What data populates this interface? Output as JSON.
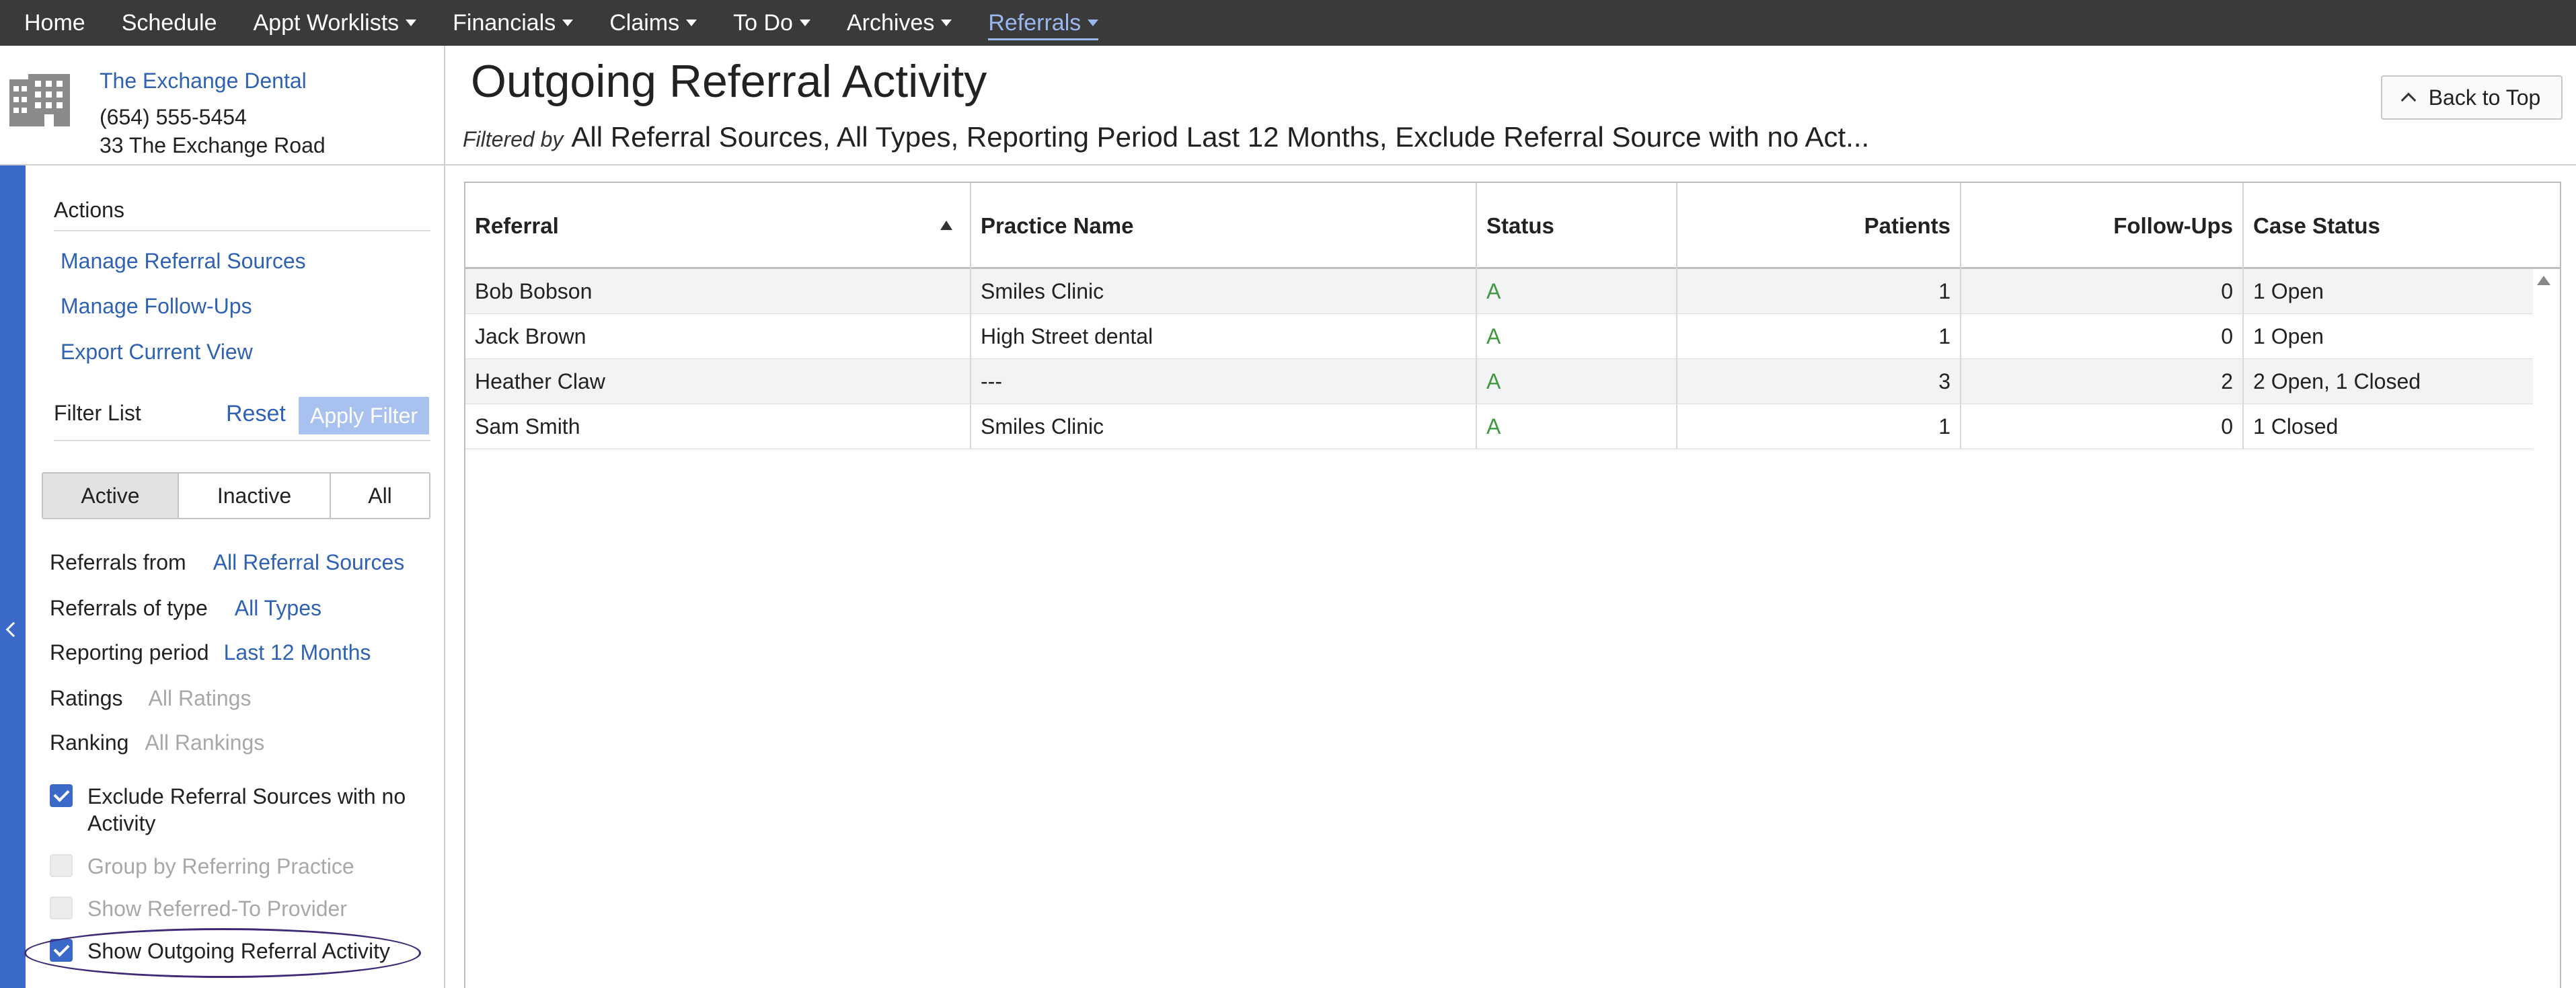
{
  "nav": {
    "items": [
      {
        "label": "Home",
        "dropdown": false,
        "active": false
      },
      {
        "label": "Schedule",
        "dropdown": false,
        "active": false
      },
      {
        "label": "Appt Worklists",
        "dropdown": true,
        "active": false
      },
      {
        "label": "Financials",
        "dropdown": true,
        "active": false
      },
      {
        "label": "Claims",
        "dropdown": true,
        "active": false
      },
      {
        "label": "To Do",
        "dropdown": true,
        "active": false
      },
      {
        "label": "Archives",
        "dropdown": true,
        "active": false
      },
      {
        "label": "Referrals",
        "dropdown": true,
        "active": true
      }
    ]
  },
  "practice": {
    "name": "The Exchange Dental",
    "phone": "(654) 555-5454",
    "address": "33 The Exchange Road"
  },
  "page": {
    "title": "Outgoing Referral Activity",
    "filtered_label": "Filtered by",
    "filtered_text": "All Referral Sources, All Types, Reporting Period Last 12 Months, Exclude Referral Source with no Act...",
    "back_to_top": "Back to Top"
  },
  "sidebar": {
    "actions_heading": "Actions",
    "actions": [
      "Manage Referral Sources",
      "Manage Follow-Ups",
      "Export Current View"
    ],
    "filter_heading": "Filter List",
    "reset_label": "Reset",
    "apply_label": "Apply Filter",
    "segments": [
      "Active",
      "Inactive",
      "All"
    ],
    "selected_segment": "Active",
    "filters": {
      "referrals_from": {
        "label": "Referrals from",
        "value": "All Referral Sources"
      },
      "referrals_type": {
        "label": "Referrals of type",
        "value": "All Types"
      },
      "reporting_period": {
        "label": "Reporting period",
        "value": "Last 12 Months"
      },
      "ratings": {
        "label": "Ratings",
        "value": "All Ratings"
      },
      "ranking": {
        "label": "Ranking",
        "value": "All Rankings"
      }
    },
    "checkboxes": {
      "exclude": {
        "label": "Exclude Referral Sources with no Activity",
        "checked": true,
        "enabled": true
      },
      "group": {
        "label": "Group by Referring Practice",
        "checked": false,
        "enabled": false
      },
      "show_provider": {
        "label": "Show Referred-To Provider",
        "checked": false,
        "enabled": false
      },
      "show_outgoing": {
        "label": "Show Outgoing Referral Activity",
        "checked": true,
        "enabled": true
      }
    }
  },
  "table": {
    "columns": [
      "Referral",
      "Practice Name",
      "Status",
      "Patients",
      "Follow-Ups",
      "Case Status"
    ],
    "sort_column": "Referral",
    "sort_direction": "ascending",
    "rows": [
      {
        "referral": "Bob Bobson",
        "practice": "Smiles Clinic",
        "status": "A",
        "patients": "1",
        "followups": "0",
        "case_status": "1 Open"
      },
      {
        "referral": "Jack Brown",
        "practice": "High Street dental",
        "status": "A",
        "patients": "1",
        "followups": "0",
        "case_status": "1 Open"
      },
      {
        "referral": "Heather Claw",
        "practice": "---",
        "status": "A",
        "patients": "3",
        "followups": "2",
        "case_status": "2 Open, 1 Closed"
      },
      {
        "referral": "Sam Smith",
        "practice": "Smiles Clinic",
        "status": "A",
        "patients": "1",
        "followups": "0",
        "case_status": "1 Closed"
      }
    ]
  },
  "colors": {
    "nav_bg": "#3a3a3a",
    "link": "#2f62b3",
    "accent_blue": "#3b69c9",
    "active_nav": "#9ab8f0",
    "status_green": "#3f9a3f",
    "highlight_ellipse": "#3f2a78"
  }
}
